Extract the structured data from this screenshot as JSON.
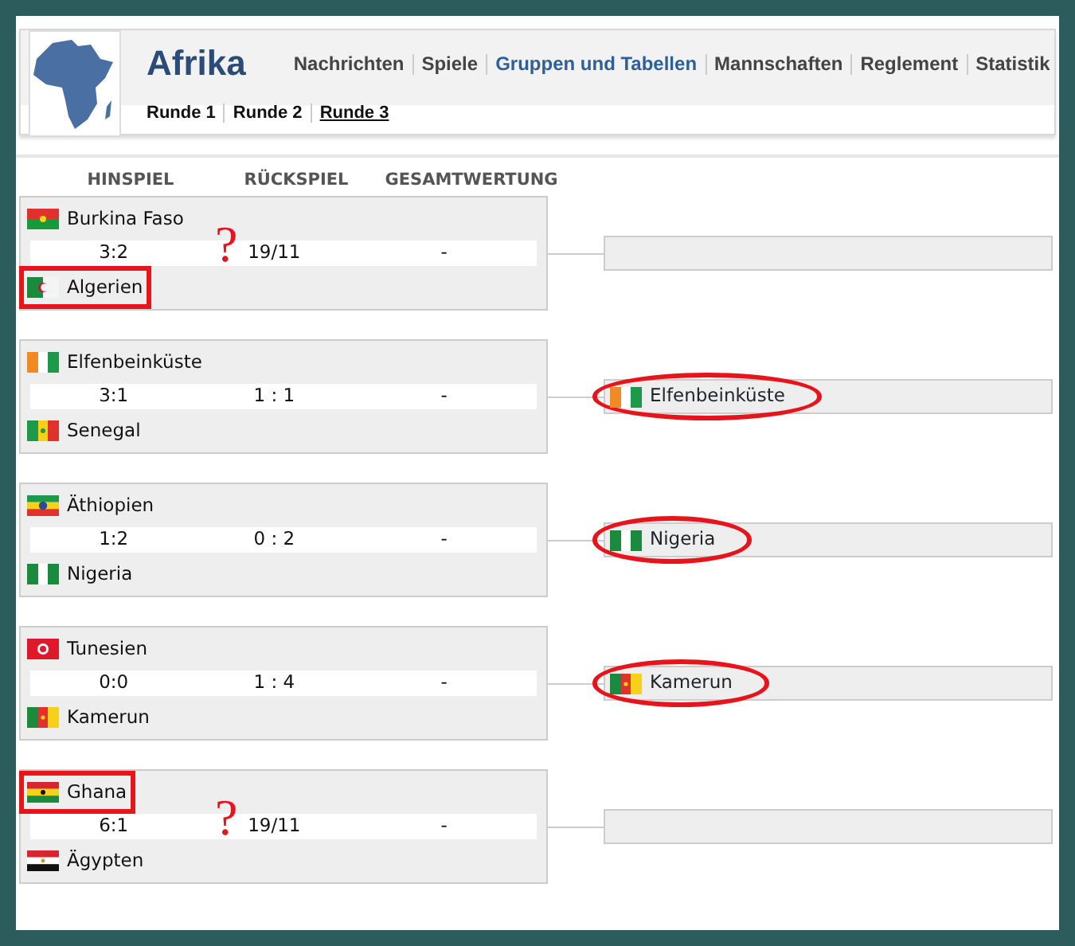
{
  "header": {
    "title": "Afrika",
    "nav": [
      {
        "label": "Nachrichten",
        "selected": false
      },
      {
        "label": "Spiele",
        "selected": false
      },
      {
        "label": "Gruppen und Tabellen",
        "selected": true
      },
      {
        "label": "Mannschaften",
        "selected": false
      },
      {
        "label": "Reglement",
        "selected": false
      },
      {
        "label": "Statistik",
        "selected": false
      }
    ],
    "subnav": [
      {
        "label": "Runde 1",
        "selected": false
      },
      {
        "label": "Runde 2",
        "selected": false
      },
      {
        "label": "Runde 3",
        "selected": true
      }
    ]
  },
  "columns": [
    "HINSPIEL",
    "RÜCKSPIEL",
    "GESAMTWERTUNG"
  ],
  "matches": [
    {
      "home": {
        "name": "Burkina Faso",
        "kind": "bf",
        "marked": false
      },
      "away": {
        "name": "Algerien",
        "kind": "dz",
        "marked": true
      },
      "first_leg": "3:2",
      "second_leg": "19/11",
      "aggregate": "-",
      "note": "?"
    },
    {
      "home": {
        "name": "Elfenbeinküste",
        "kind": "ci",
        "marked": false
      },
      "away": {
        "name": "Senegal",
        "kind": "sn",
        "marked": false
      },
      "first_leg": "3:1",
      "second_leg": "1 : 1",
      "aggregate": "-",
      "winner": {
        "name": "Elfenbeinküste",
        "kind": "ci",
        "marked": true
      }
    },
    {
      "home": {
        "name": "Äthiopien",
        "kind": "et",
        "marked": false
      },
      "away": {
        "name": "Nigeria",
        "kind": "ng",
        "marked": false
      },
      "first_leg": "1:2",
      "second_leg": "0 : 2",
      "aggregate": "-",
      "winner": {
        "name": "Nigeria",
        "kind": "ng",
        "marked": true
      }
    },
    {
      "home": {
        "name": "Tunesien",
        "kind": "tn",
        "marked": false
      },
      "away": {
        "name": "Kamerun",
        "kind": "cm",
        "marked": false
      },
      "first_leg": "0:0",
      "second_leg": "1 : 4",
      "aggregate": "-",
      "winner": {
        "name": "Kamerun",
        "kind": "cm",
        "marked": true
      }
    },
    {
      "home": {
        "name": "Ghana",
        "kind": "gh",
        "marked": true
      },
      "away": {
        "name": "Ägypten",
        "kind": "eg",
        "marked": false
      },
      "first_leg": "6:1",
      "second_leg": "19/11",
      "aggregate": "-",
      "note": "?"
    }
  ]
}
